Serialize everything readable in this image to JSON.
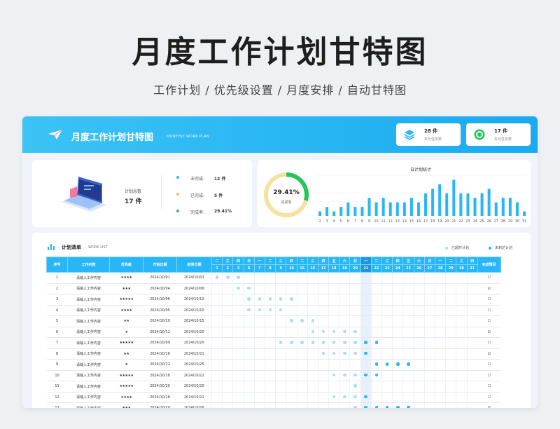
{
  "hero": {
    "title": "月度工作计划甘特图",
    "subtitle": "工作计划 / 优先级设置 / 月度安排 / 自动甘特图"
  },
  "header": {
    "title": "月度工作计划甘特图",
    "subtitle": "MONTHLY WORK PLAN",
    "stats": [
      {
        "value": "28 件",
        "label": "本月任务数",
        "icon": "stack-icon",
        "color": "#29b6f6"
      },
      {
        "value": "17 件",
        "label": "本月任务数",
        "icon": "progress-ring-icon",
        "color": "#22c55e"
      }
    ]
  },
  "summary": {
    "total_label": "计划总数",
    "total_value": "17 件",
    "rows": [
      {
        "label": "未完成:",
        "value": "12 件",
        "color": "#29b6f6"
      },
      {
        "label": "已完成:",
        "value": "5 件",
        "color": "#f5c242"
      },
      {
        "label": "完成率:",
        "value": "29.41%",
        "color": "#4caf50"
      }
    ]
  },
  "ring": {
    "value": "29.41%",
    "label": "完成率",
    "fraction": 0.2941,
    "color_done": "#22c55e",
    "color_rest": "#f7e1a1"
  },
  "chart_data": {
    "type": "bar",
    "title": "日计划统计",
    "categories": [
      "2",
      "3",
      "4",
      "5",
      "6",
      "7",
      "8",
      "9",
      "10",
      "11",
      "12",
      "13",
      "14",
      "15",
      "16",
      "17",
      "18",
      "19",
      "20",
      "21",
      "22",
      "23",
      "24",
      "25",
      "26",
      "27",
      "28",
      "29",
      "30",
      "31"
    ],
    "values": [
      1,
      2,
      1,
      2,
      3,
      2,
      2,
      4,
      3,
      4,
      3,
      3,
      3,
      4,
      3,
      5,
      6,
      7,
      5,
      8,
      5,
      5,
      4,
      5,
      6,
      3,
      4,
      4,
      3,
      1
    ],
    "ylim": [
      0,
      9
    ],
    "color": "#29b6f6"
  },
  "table": {
    "title": "计划清单",
    "subtitle": "WORK LIST",
    "legend": [
      {
        "label": "已超时计划",
        "color": "#a9ddf5"
      },
      {
        "label": "未到达计划",
        "color": "#29b6f6"
      }
    ],
    "headers": {
      "no": "序号",
      "content": "工作内容",
      "priority": "优先级",
      "start": "开始日期",
      "end": "结束日期",
      "status": "完成情况"
    },
    "weekdays": [
      "二",
      "三",
      "四",
      "日",
      "一",
      "二",
      "三",
      "四",
      "二",
      "三",
      "四",
      "五",
      "六",
      "日",
      "一",
      "二",
      "三",
      "四",
      "五",
      "六",
      "日",
      "一",
      "二",
      "三",
      "四"
    ],
    "days": [
      "1",
      "2",
      "3",
      "6",
      "7",
      "8",
      "9",
      "10",
      "15",
      "16",
      "17",
      "18",
      "19",
      "20",
      "21",
      "22",
      "23",
      "24",
      "25",
      "26",
      "27",
      "28",
      "29",
      "30",
      "31"
    ],
    "today_index": 14,
    "rows": [
      {
        "no": "1",
        "content": "请输入工作内容",
        "priority": "★★★★",
        "start": "2024/10/01",
        "end": "2024/10/03",
        "status": "☐",
        "light": [
          0,
          1,
          2
        ],
        "dark": []
      },
      {
        "no": "2",
        "content": "请输入工作内容",
        "priority": "★★★",
        "start": "2024/10/04",
        "end": "2024/10/06",
        "status": "☑",
        "light": [
          2,
          3
        ],
        "dark": []
      },
      {
        "no": "3",
        "content": "请输入工作内容",
        "priority": "★★★★★",
        "start": "2024/10/06",
        "end": "2024/10/12",
        "status": "☐",
        "light": [
          3,
          4,
          5,
          6,
          7
        ],
        "dark": []
      },
      {
        "no": "4",
        "content": "请输入工作内容",
        "priority": "★★★★",
        "start": "2024/10/05",
        "end": "2024/10/10",
        "status": "☐",
        "light": [
          3,
          4,
          5,
          6
        ],
        "dark": []
      },
      {
        "no": "5",
        "content": "请输入工作内容",
        "priority": "★★",
        "start": "2024/10/10",
        "end": "2024/10/15",
        "status": "☐",
        "light": [
          7,
          8,
          9
        ],
        "dark": []
      },
      {
        "no": "6",
        "content": "请输入工作内容",
        "priority": "★",
        "start": "2024/10/12",
        "end": "2024/10/20",
        "status": "☑",
        "light": [
          9,
          10,
          11,
          12,
          13
        ],
        "dark": []
      },
      {
        "no": "7",
        "content": "请输入工作内容",
        "priority": "★★★★★",
        "start": "2024/10/09",
        "end": "2024/10/20",
        "status": "☐",
        "light": [
          6,
          7,
          8,
          9,
          10,
          11,
          12,
          13
        ],
        "dark": [
          14,
          15
        ]
      },
      {
        "no": "8",
        "content": "请输入工作内容",
        "priority": "★★",
        "start": "2024/10/16",
        "end": "2024/10/21",
        "status": "☑",
        "light": [
          10,
          11,
          12,
          13
        ],
        "dark": [
          14
        ]
      },
      {
        "no": "9",
        "content": "请输入工作内容",
        "priority": "★",
        "start": "2024/10/22",
        "end": "2024/10/25",
        "status": "☐",
        "light": [],
        "dark": [
          15,
          16,
          17,
          18
        ]
      },
      {
        "no": "10",
        "content": "请输入工作内容",
        "priority": "★★★★★",
        "start": "2024/10/18",
        "end": "2024/10/22",
        "status": "☐",
        "light": [
          11,
          12,
          13
        ],
        "dark": [
          14,
          15
        ]
      },
      {
        "no": "11",
        "content": "请输入工作内容",
        "priority": "★★★★★",
        "start": "2024/10/20",
        "end": "2024/10/20",
        "status": "☐",
        "light": [
          13
        ],
        "dark": []
      },
      {
        "no": "12",
        "content": "请输入工作内容",
        "priority": "★★★★",
        "start": "2024/10/18",
        "end": "2024/10/21",
        "status": "☐",
        "light": [
          11,
          12,
          13
        ],
        "dark": [
          14
        ]
      },
      {
        "no": "13",
        "content": "请输入工作内容",
        "priority": "★★★",
        "start": "2024/10/20",
        "end": "2024/10/26",
        "status": "☑",
        "light": [
          13
        ],
        "dark": [
          14,
          15,
          16,
          17,
          18
        ]
      }
    ]
  }
}
